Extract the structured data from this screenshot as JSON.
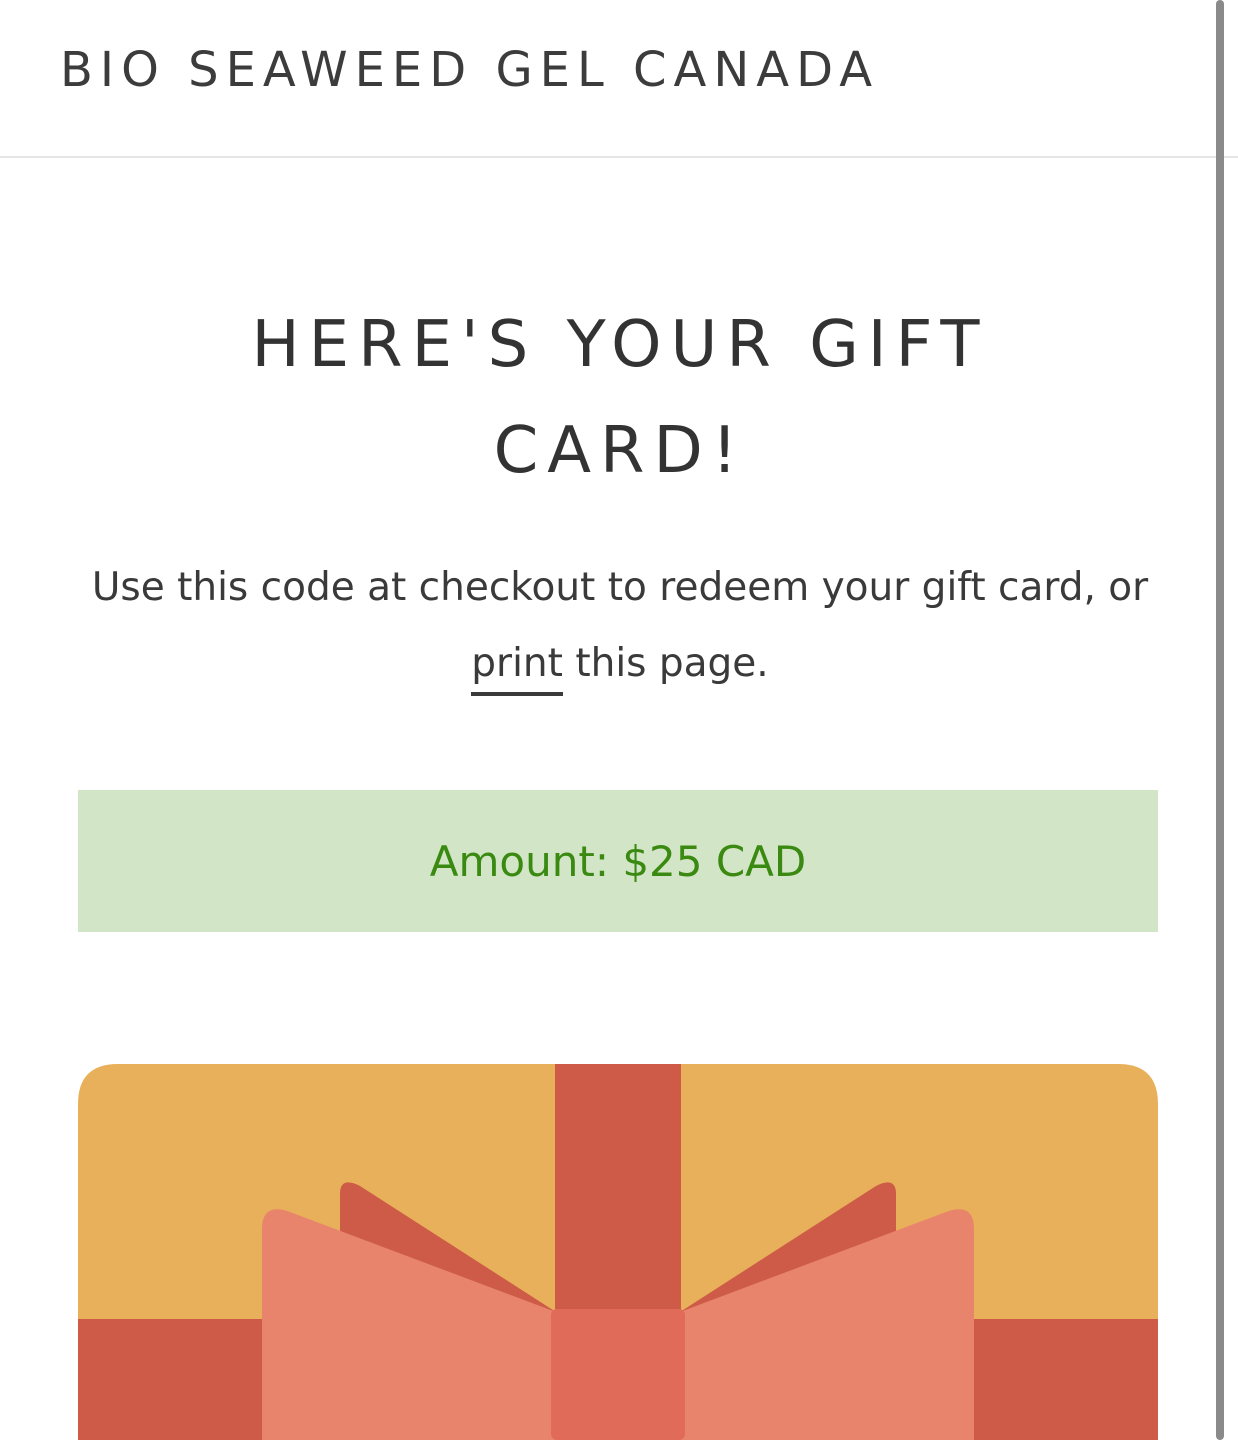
{
  "header": {
    "store_name": "BIO SEAWEED GEL CANADA"
  },
  "main": {
    "title": "HERE'S YOUR GIFT CARD!",
    "subtitle_before": "Use this code at checkout to redeem your gift card, or ",
    "print_link": "print",
    "subtitle_after": " this page.",
    "amount": "Amount: $25 CAD"
  },
  "colors": {
    "amount_background": "#d3e5c7",
    "amount_text": "#3a8a12",
    "gift_card_gold": "#e8b05a",
    "ribbon_red": "#cd5b47",
    "bow_salmon": "#e8846c",
    "bow_knot": "#e06b58"
  },
  "icons": {
    "gift_card_image": "gift-box-with-bow"
  }
}
